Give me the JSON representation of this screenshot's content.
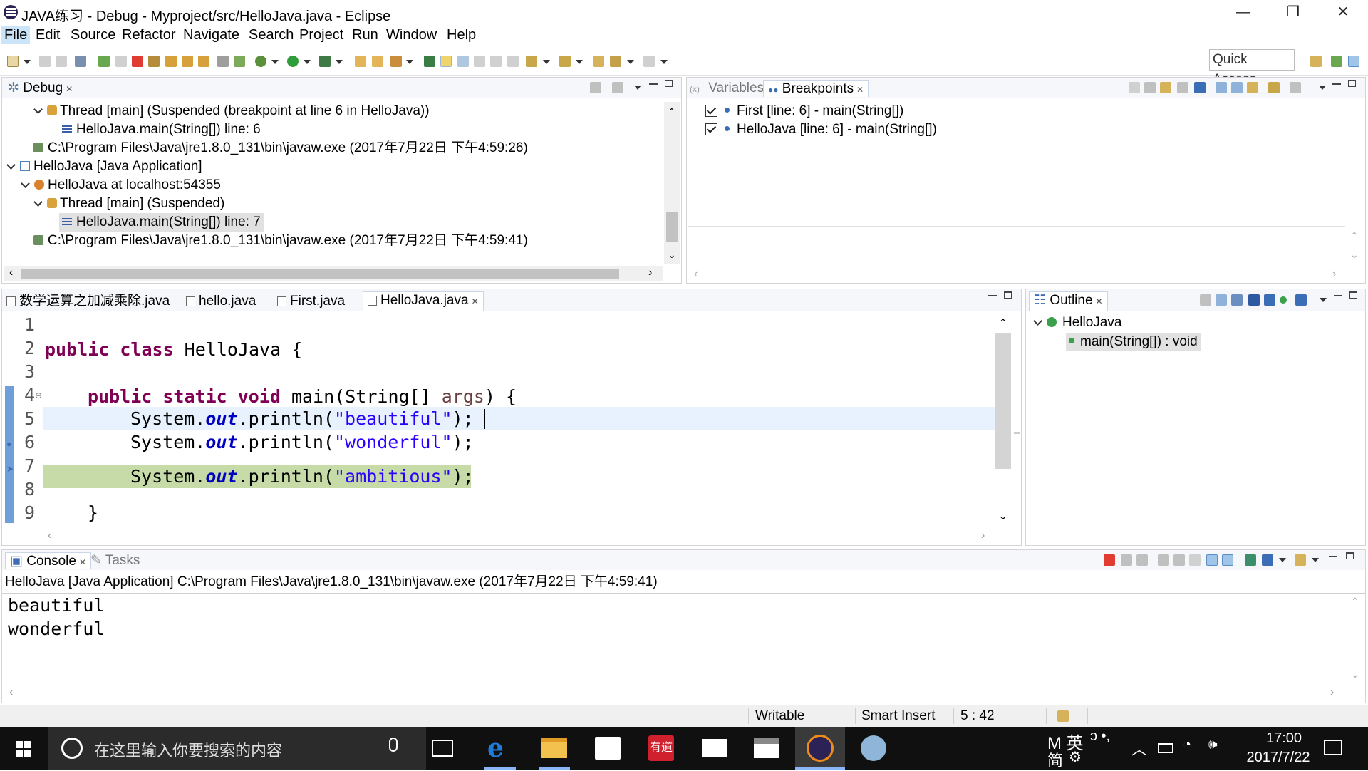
{
  "window": {
    "title": "JAVA练习 - Debug - Myproject/src/HelloJava.java - Eclipse"
  },
  "menu": [
    "File",
    "Edit",
    "Source",
    "Refactor",
    "Navigate",
    "Search",
    "Project",
    "Run",
    "Window",
    "Help"
  ],
  "toolbar": {
    "quick_access": "Quick Access"
  },
  "debug_view": {
    "tab": "Debug",
    "rows": [
      "Thread [main] (Suspended (breakpoint at line 6 in HelloJava))",
      "HelloJava.main(String[]) line: 6",
      "C:\\Program Files\\Java\\jre1.8.0_131\\bin\\javaw.exe (2017年7月22日 下午4:59:26)",
      "HelloJava [Java Application]",
      "HelloJava at localhost:54355",
      "Thread [main] (Suspended)",
      "HelloJava.main(String[]) line: 7",
      "C:\\Program Files\\Java\\jre1.8.0_131\\bin\\javaw.exe (2017年7月22日 下午4:59:41)"
    ]
  },
  "breakpoints_view": {
    "tabs": [
      "Variables",
      "Breakpoints"
    ],
    "items": [
      "First [line: 6] - main(String[])",
      "HelloJava [line: 6] - main(String[])"
    ]
  },
  "editor": {
    "tabs": [
      "数学运算之加减乘除.java",
      "hello.java",
      "First.java",
      "HelloJava.java"
    ],
    "line_numbers": [
      "1",
      "2",
      "3",
      "4",
      "5",
      "6",
      "7",
      "8",
      "9"
    ],
    "lines": {
      "l2a": "public class",
      "l2b": " HelloJava {",
      "l4a": "public static void",
      "l4b": " main(String[] ",
      "l4c": "args",
      "l4d": ") {",
      "l5a": "System.",
      "l5b": "out",
      "l5c": ".println(",
      "l5d": "\"beautiful\"",
      "l5e": ");",
      "l6a": "System.",
      "l6b": "out",
      "l6c": ".println(",
      "l6d": "\"wonderful\"",
      "l6e": ");",
      "l7a": "System.",
      "l7b": "out",
      "l7c": ".println(",
      "l7d": "\"ambitious\"",
      "l7e": ");",
      "l9": "}"
    }
  },
  "outline": {
    "tab": "Outline",
    "class": "HelloJava",
    "method": "main(String[]) : void"
  },
  "console": {
    "tabs": [
      "Console",
      "Tasks"
    ],
    "header": "HelloJava [Java Application] C:\\Program Files\\Java\\jre1.8.0_131\\bin\\javaw.exe (2017年7月22日 下午4:59:41)",
    "output": [
      "beautiful",
      "wonderful"
    ]
  },
  "status": {
    "writable": "Writable",
    "insert_mode": "Smart Insert",
    "position": "5 : 42"
  },
  "taskbar": {
    "search_placeholder": "在这里输入你要搜索的内容",
    "ime": "M 英",
    "ime2": "简",
    "time": "17:00",
    "date": "2017/7/22"
  }
}
